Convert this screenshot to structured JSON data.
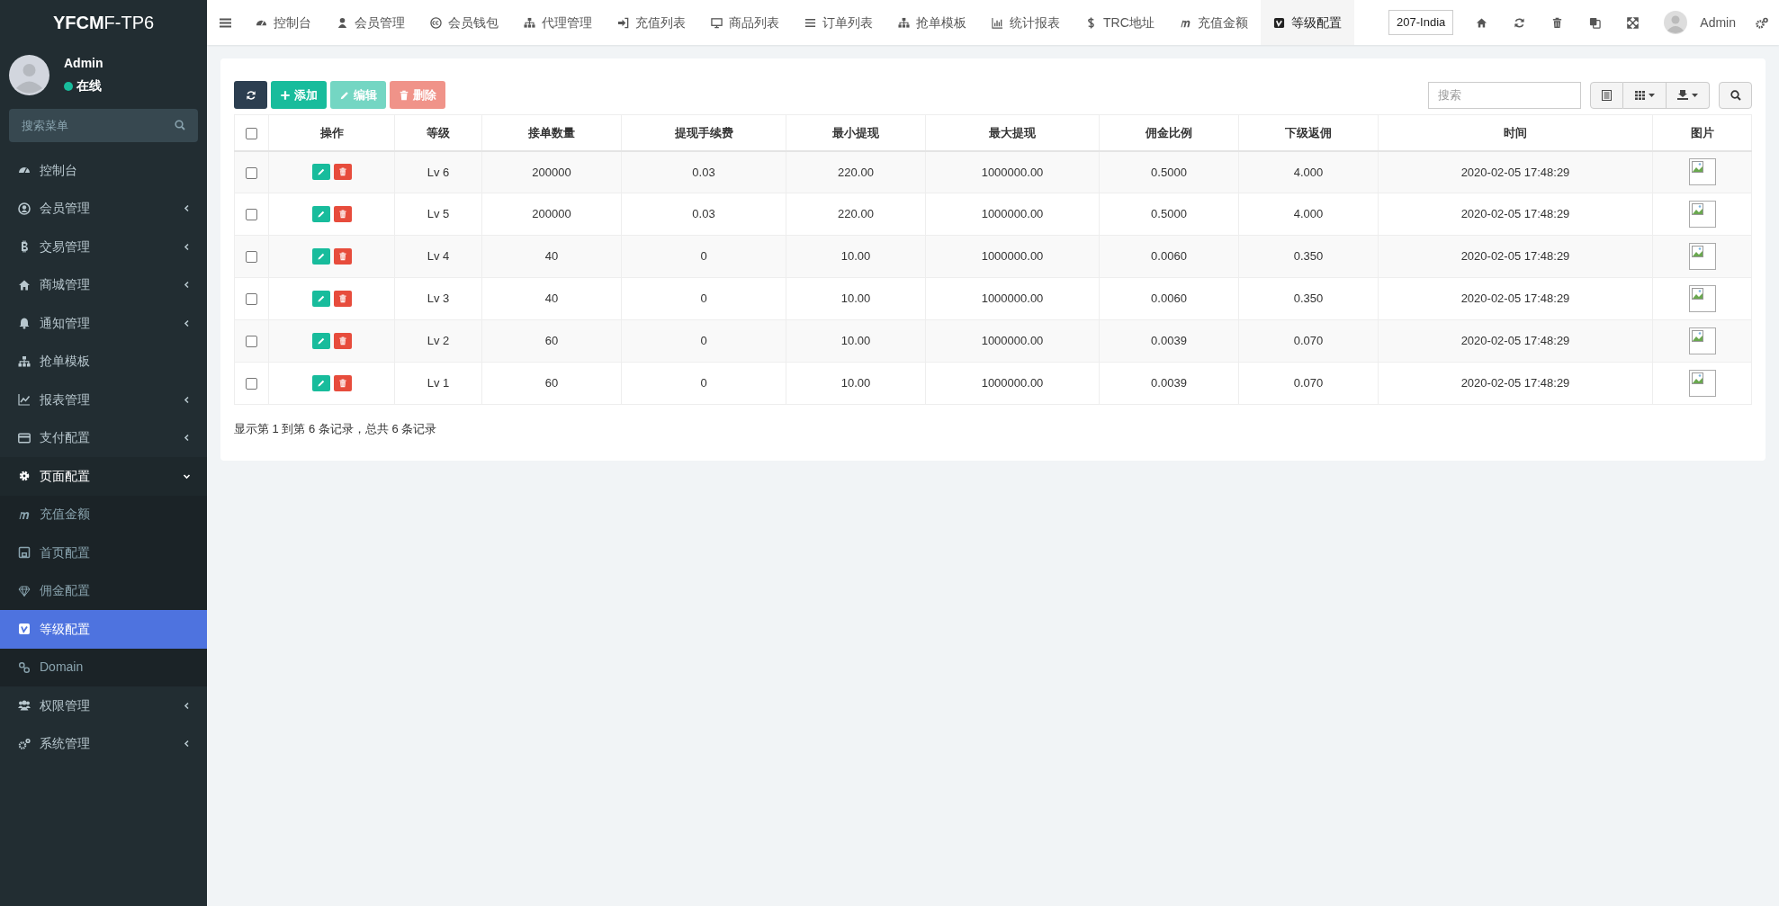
{
  "brand": {
    "bold": "YFCM",
    "rest": "F-TP6"
  },
  "user": {
    "name": "Admin",
    "status": "在线"
  },
  "sidebar": {
    "search": {
      "placeholder": "搜索菜单"
    },
    "items": [
      {
        "label": "控制台",
        "has_arrow": false,
        "expanded": false,
        "selected": false
      },
      {
        "label": "会员管理",
        "has_arrow": true,
        "expanded": false,
        "selected": false
      },
      {
        "label": "交易管理",
        "has_arrow": true,
        "expanded": false,
        "selected": false
      },
      {
        "label": "商城管理",
        "has_arrow": true,
        "expanded": false,
        "selected": false
      },
      {
        "label": "通知管理",
        "has_arrow": true,
        "expanded": false,
        "selected": false
      },
      {
        "label": "抢单模板",
        "has_arrow": false,
        "expanded": false,
        "selected": false
      },
      {
        "label": "报表管理",
        "has_arrow": true,
        "expanded": false,
        "selected": false
      },
      {
        "label": "支付配置",
        "has_arrow": true,
        "expanded": false,
        "selected": false
      },
      {
        "label": "页面配置",
        "has_arrow": true,
        "expanded": true,
        "selected": false,
        "children": [
          {
            "label": "充值金额",
            "selected": false
          },
          {
            "label": "首页配置",
            "selected": false
          },
          {
            "label": "佣金配置",
            "selected": false
          },
          {
            "label": "等级配置",
            "selected": true
          },
          {
            "label": "Domain",
            "selected": false
          }
        ]
      },
      {
        "label": "权限管理",
        "has_arrow": true,
        "expanded": false,
        "selected": false
      },
      {
        "label": "系统管理",
        "has_arrow": true,
        "expanded": false,
        "selected": false
      }
    ]
  },
  "top_tabs": [
    {
      "label": "控制台",
      "selected": false
    },
    {
      "label": "会员管理",
      "selected": false
    },
    {
      "label": "会员钱包",
      "selected": false
    },
    {
      "label": "代理管理",
      "selected": false
    },
    {
      "label": "充值列表",
      "selected": false
    },
    {
      "label": "商品列表",
      "selected": false
    },
    {
      "label": "订单列表",
      "selected": false
    },
    {
      "label": "抢单模板",
      "selected": false
    },
    {
      "label": "统计报表",
      "selected": false
    },
    {
      "label": "TRC地址",
      "selected": false
    },
    {
      "label": "充值金额",
      "selected": false
    },
    {
      "label": "等级配置",
      "selected": true
    }
  ],
  "top_right": {
    "site": "207-India",
    "user": "Admin"
  },
  "toolbar": {
    "buttons": [
      {
        "kind": "refresh",
        "disabled": false
      },
      {
        "kind": "add",
        "label": "添加",
        "disabled": false
      },
      {
        "kind": "edit",
        "label": "编辑",
        "disabled": true
      },
      {
        "kind": "delete",
        "label": "删除",
        "disabled": true
      }
    ],
    "search": {
      "placeholder": "搜索"
    }
  },
  "table": {
    "header_checked": false,
    "columns": [
      "操作",
      "等级",
      "接单数量",
      "提现手续费",
      "最小提现",
      "最大提现",
      "佣金比例",
      "下级返佣",
      "时间",
      "图片"
    ],
    "rows": [
      {
        "checked": false,
        "cells": [
          "",
          "Lv 6",
          "200000",
          "0.03",
          "220.00",
          "1000000.00",
          "0.5000",
          "4.000",
          "2020-02-05 17:48:29"
        ]
      },
      {
        "checked": false,
        "cells": [
          "",
          "Lv 5",
          "200000",
          "0.03",
          "220.00",
          "1000000.00",
          "0.5000",
          "4.000",
          "2020-02-05 17:48:29"
        ]
      },
      {
        "checked": false,
        "cells": [
          "",
          "Lv 4",
          "40",
          "0",
          "10.00",
          "1000000.00",
          "0.0060",
          "0.350",
          "2020-02-05 17:48:29"
        ]
      },
      {
        "checked": false,
        "cells": [
          "",
          "Lv 3",
          "40",
          "0",
          "10.00",
          "1000000.00",
          "0.0060",
          "0.350",
          "2020-02-05 17:48:29"
        ]
      },
      {
        "checked": false,
        "cells": [
          "",
          "Lv 2",
          "60",
          "0",
          "10.00",
          "1000000.00",
          "0.0039",
          "0.070",
          "2020-02-05 17:48:29"
        ]
      },
      {
        "checked": false,
        "cells": [
          "",
          "Lv 1",
          "60",
          "0",
          "10.00",
          "1000000.00",
          "0.0039",
          "0.070",
          "2020-02-05 17:48:29"
        ]
      }
    ]
  },
  "pagination": {
    "summary": "显示第 1 到第 6 条记录，总共 6 条记录"
  }
}
